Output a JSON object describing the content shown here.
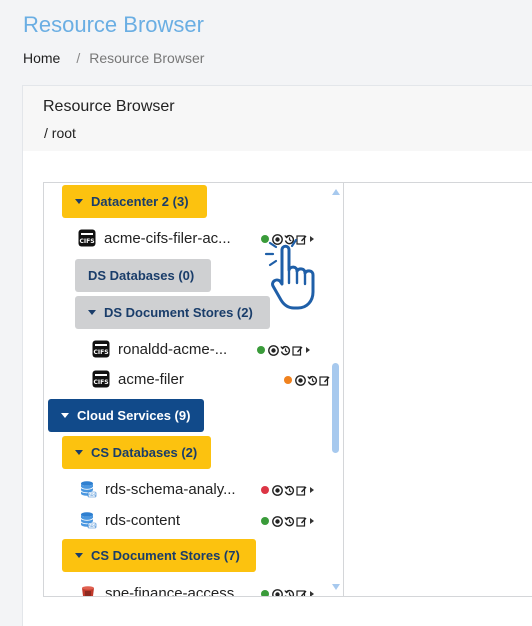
{
  "page": {
    "title": "Resource Browser",
    "breadcrumb": {
      "home": "Home",
      "separator": "/",
      "current": "Resource Browser"
    }
  },
  "card": {
    "title": "Resource Browser",
    "path": "/ root"
  },
  "tree": {
    "nodes": [
      {
        "kind": "folder",
        "label": "Datacenter 2 (3)",
        "style": "yellow",
        "expanded": true
      },
      {
        "kind": "leaf",
        "label": "acme-cifs-filer-ac...",
        "icon": "cifs-icon",
        "status": "green"
      },
      {
        "kind": "folder",
        "label": "DS Databases (0)",
        "style": "gray",
        "expanded": false
      },
      {
        "kind": "folder",
        "label": "DS Document Stores (2)",
        "style": "gray",
        "expanded": true
      },
      {
        "kind": "leaf",
        "label": "ronaldd-acme-...",
        "icon": "cifs-icon",
        "status": "green"
      },
      {
        "kind": "leaf",
        "label": "acme-filer",
        "icon": "cifs-icon",
        "status": "orange"
      },
      {
        "kind": "folder",
        "label": "Cloud Services (9)",
        "style": "blue",
        "expanded": true
      },
      {
        "kind": "folder",
        "label": "CS Databases (2)",
        "style": "yellow",
        "expanded": true
      },
      {
        "kind": "leaf",
        "label": "rds-schema-analy...",
        "icon": "rds-database-icon",
        "status": "red"
      },
      {
        "kind": "leaf",
        "label": "rds-content",
        "icon": "rds-database-icon",
        "status": "green"
      },
      {
        "kind": "folder",
        "label": "CS Document Stores (7)",
        "style": "yellow",
        "expanded": true
      },
      {
        "kind": "leaf",
        "label": "spe-finance-access",
        "icon": "s3-bucket-icon",
        "status": "green"
      }
    ]
  },
  "colors": {
    "title": "#6aaee3",
    "folder_yellow": "#fcc20f",
    "folder_gray": "#cfd0d2",
    "folder_blue": "#114a8a",
    "status_green": "#3a9b3a",
    "status_orange": "#f0821e",
    "status_red": "#dc3545",
    "scrollbar": "#a7c9ee",
    "cursor": "#1f5fa8"
  }
}
